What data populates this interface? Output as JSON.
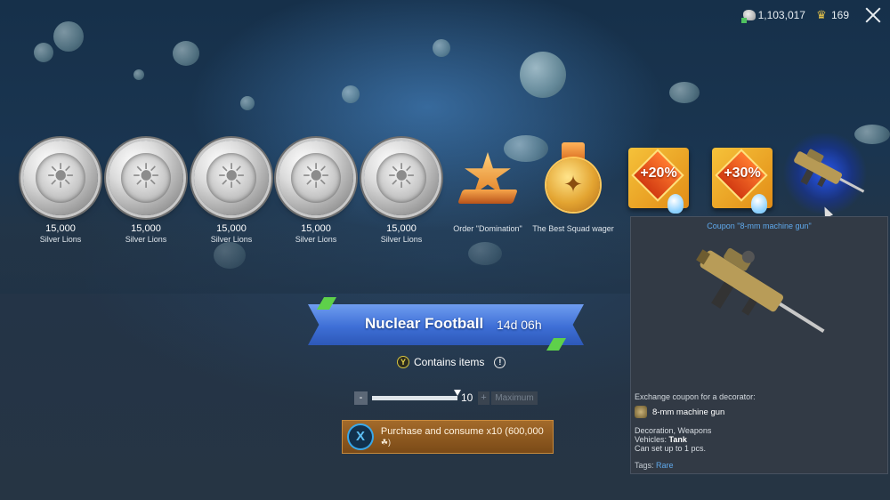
{
  "header": {
    "silver_lions": "1,103,017",
    "golden_eagles": "169"
  },
  "items": [
    {
      "amount": "15,000",
      "label": "Silver Lions",
      "icon": "silver-lion-coin-icon"
    },
    {
      "amount": "15,000",
      "label": "Silver Lions",
      "icon": "silver-lion-coin-icon"
    },
    {
      "amount": "15,000",
      "label": "Silver Lions",
      "icon": "silver-lion-coin-icon"
    },
    {
      "amount": "15,000",
      "label": "Silver Lions",
      "icon": "silver-lion-coin-icon"
    },
    {
      "amount": "15,000",
      "label": "Silver Lions",
      "icon": "silver-lion-coin-icon"
    },
    {
      "amount": "",
      "label": "Order \"Domination\"",
      "icon": "order-star-icon"
    },
    {
      "amount": "",
      "label": "The Best Squad wager",
      "icon": "medal-icon"
    },
    {
      "amount": "",
      "label": "",
      "icon": "coupon-20-icon",
      "pct": "+20%"
    },
    {
      "amount": "",
      "label": "",
      "icon": "coupon-30-icon",
      "pct": "+30%"
    },
    {
      "amount": "",
      "label": "",
      "icon": "machine-gun-icon"
    }
  ],
  "event": {
    "title": "Nuclear Football",
    "timer": "14d 06h",
    "contains_button": "Y",
    "contains_label": "Contains items",
    "info_icon": "!"
  },
  "quantity": {
    "minus": "-",
    "value": "10",
    "plus": "+",
    "max_label": "Maximum",
    "slider_fraction": 1.0
  },
  "purchase": {
    "button_key": "X",
    "label": "Purchase and consume x10 (600,000"
  },
  "panel": {
    "title": "Coupon \"8-mm machine gun\"",
    "description": "Exchange coupon for a decorator:",
    "item_name": "8-mm machine gun",
    "category": "Decoration, Weapons",
    "vehicles_label": "Vehicles:",
    "vehicles_value": "Tank",
    "limit": "Can set up to 1 pcs.",
    "tags_label": "Tags:",
    "tags_value": "Rare"
  },
  "colors": {
    "accent_blue": "#5fa9ec",
    "purchase_bg": "#8b5a22",
    "banner_blue": "#3e6fd6"
  }
}
